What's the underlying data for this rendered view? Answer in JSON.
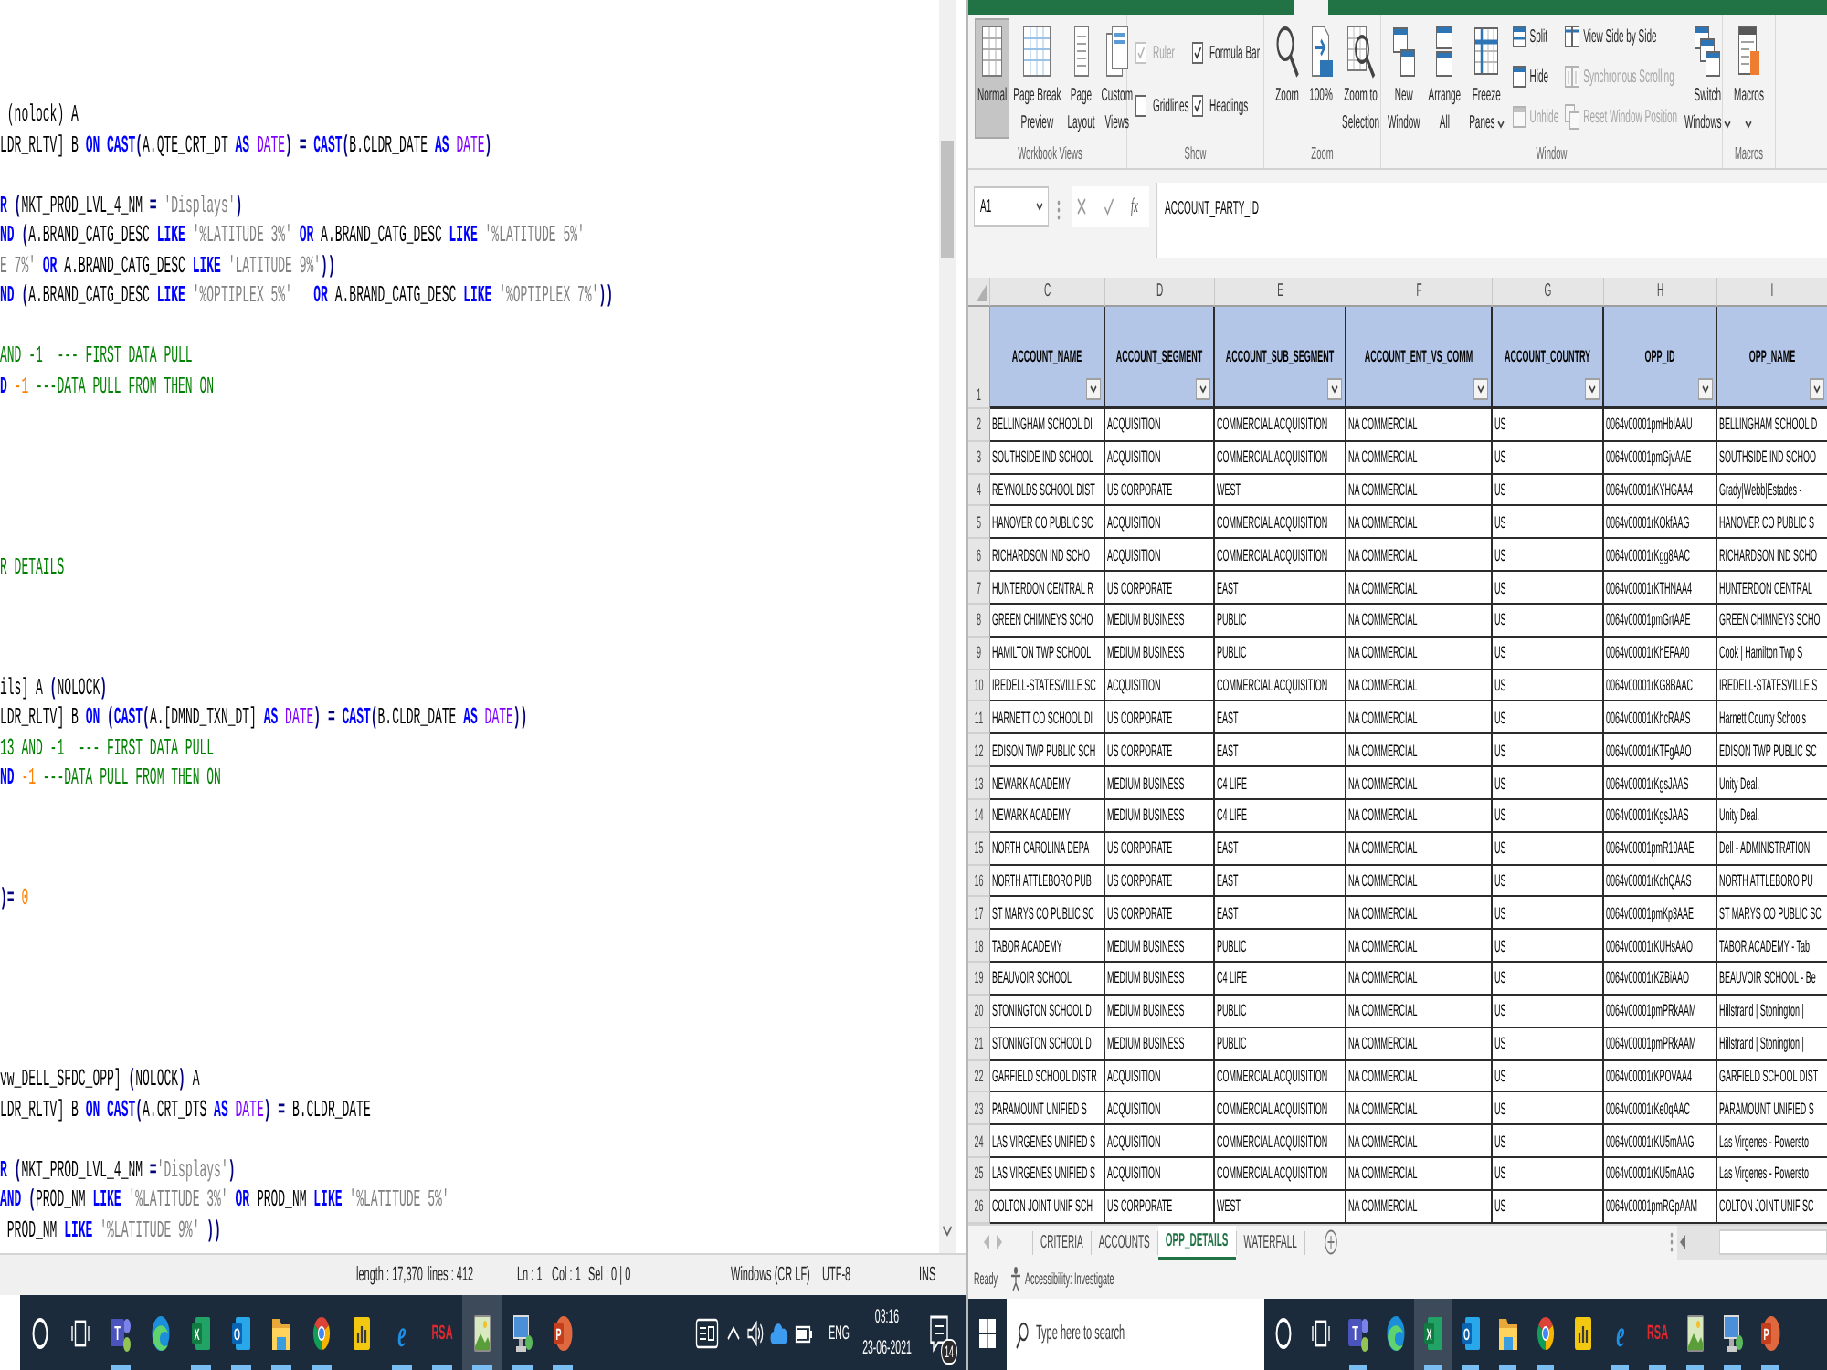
{
  "editor": {
    "lines": [
      {
        "kind": "code",
        "segments": [
          {
            "kind": "plain",
            "text": " (nolock) A"
          }
        ]
      },
      {
        "kind": "code",
        "segments": [
          {
            "kind": "plain",
            "text": "LDR_RLTV] B "
          },
          {
            "kind": "keyword",
            "text": "ON"
          },
          {
            "kind": "keyword",
            "text": " CAST"
          },
          {
            "kind": "operator",
            "text": "("
          },
          {
            "kind": "plain",
            "text": "A.QTE_CRT_DT "
          },
          {
            "kind": "keyword",
            "text": "AS"
          },
          {
            "kind": "type",
            "text": " DATE"
          },
          {
            "kind": "operator",
            "text": ") ="
          },
          {
            "kind": "keyword",
            "text": " CAST"
          },
          {
            "kind": "operator",
            "text": "("
          },
          {
            "kind": "plain",
            "text": "B.CLDR_DATE "
          },
          {
            "kind": "keyword",
            "text": "AS"
          },
          {
            "kind": "type",
            "text": " DATE"
          },
          {
            "kind": "operator",
            "text": ")"
          }
        ]
      },
      {
        "kind": "blank"
      },
      {
        "kind": "code",
        "segments": [
          {
            "kind": "keyword",
            "text": "R"
          },
          {
            "kind": "operator",
            "text": " ("
          },
          {
            "kind": "plain",
            "text": "MKT_PROD_LVL_4_NM "
          },
          {
            "kind": "operator",
            "text": "="
          },
          {
            "kind": "string",
            "text": " 'Displays'"
          },
          {
            "kind": "operator",
            "text": ")"
          }
        ]
      },
      {
        "kind": "code",
        "segments": [
          {
            "kind": "keyword",
            "text": "ND"
          },
          {
            "kind": "operator",
            "text": " ("
          },
          {
            "kind": "plain",
            "text": "A.BRAND_CATG_DESC "
          },
          {
            "kind": "keyword",
            "text": "LIKE"
          },
          {
            "kind": "string",
            "text": " '%LATITUDE 3%'"
          },
          {
            "kind": "keyword",
            "text": " OR"
          },
          {
            "kind": "plain",
            "text": " A.BRAND_CATG_DESC "
          },
          {
            "kind": "keyword",
            "text": "LIKE"
          },
          {
            "kind": "string",
            "text": " '%LATITUDE 5%'"
          }
        ]
      },
      {
        "kind": "code",
        "segments": [
          {
            "kind": "string",
            "text": "E 7%'"
          },
          {
            "kind": "keyword",
            "text": " OR"
          },
          {
            "kind": "plain",
            "text": " A.BRAND_CATG_DESC "
          },
          {
            "kind": "keyword",
            "text": "LIKE"
          },
          {
            "kind": "string",
            "text": " 'LATITUDE 9%'"
          },
          {
            "kind": "operator",
            "text": "))"
          }
        ]
      },
      {
        "kind": "code",
        "segments": [
          {
            "kind": "keyword",
            "text": "ND"
          },
          {
            "kind": "operator",
            "text": " ("
          },
          {
            "kind": "plain",
            "text": "A.BRAND_CATG_DESC "
          },
          {
            "kind": "keyword",
            "text": "LIKE"
          },
          {
            "kind": "string",
            "text": " '%OPTIPLEX 5%'"
          },
          {
            "kind": "keyword",
            "text": "   OR"
          },
          {
            "kind": "plain",
            "text": " A.BRAND_CATG_DESC "
          },
          {
            "kind": "keyword",
            "text": "LIKE"
          },
          {
            "kind": "string",
            "text": " '%OPTIPLEX 7%'"
          },
          {
            "kind": "operator",
            "text": "))"
          }
        ]
      },
      {
        "kind": "blank"
      },
      {
        "kind": "code",
        "segments": [
          {
            "kind": "comment",
            "text": "AND -1  --- FIRST DATA PULL"
          }
        ]
      },
      {
        "kind": "code",
        "segments": [
          {
            "kind": "keyword",
            "text": "D"
          },
          {
            "kind": "number",
            "text": " -1"
          },
          {
            "kind": "comment",
            "text": " ---DATA PULL FROM THEN ON"
          }
        ]
      },
      {
        "kind": "blank"
      },
      {
        "kind": "blank"
      },
      {
        "kind": "blank"
      },
      {
        "kind": "blank"
      },
      {
        "kind": "blank"
      },
      {
        "kind": "code",
        "segments": [
          {
            "kind": "comment",
            "text": "R DETAILS"
          }
        ]
      },
      {
        "kind": "blank"
      },
      {
        "kind": "blank"
      },
      {
        "kind": "blank"
      },
      {
        "kind": "code",
        "segments": [
          {
            "kind": "plain",
            "text": "ils] A "
          },
          {
            "kind": "operator",
            "text": "("
          },
          {
            "kind": "plain",
            "text": "NOLOCK"
          },
          {
            "kind": "operator",
            "text": ")"
          }
        ]
      },
      {
        "kind": "code",
        "segments": [
          {
            "kind": "plain",
            "text": "LDR_RLTV] B "
          },
          {
            "kind": "keyword",
            "text": "ON"
          },
          {
            "kind": "operator",
            "text": " ("
          },
          {
            "kind": "keyword",
            "text": "CAST"
          },
          {
            "kind": "operator",
            "text": "("
          },
          {
            "kind": "plain",
            "text": "A.[DMND_TXN_DT] "
          },
          {
            "kind": "keyword",
            "text": "AS"
          },
          {
            "kind": "type",
            "text": " DATE"
          },
          {
            "kind": "operator",
            "text": ") ="
          },
          {
            "kind": "keyword",
            "text": " CAST"
          },
          {
            "kind": "operator",
            "text": "("
          },
          {
            "kind": "plain",
            "text": "B.CLDR_DATE "
          },
          {
            "kind": "keyword",
            "text": "AS"
          },
          {
            "kind": "type",
            "text": " DATE"
          },
          {
            "kind": "operator",
            "text": "))"
          }
        ]
      },
      {
        "kind": "code",
        "segments": [
          {
            "kind": "comment",
            "text": "13 AND -1  --- FIRST DATA PULL"
          }
        ]
      },
      {
        "kind": "code",
        "segments": [
          {
            "kind": "keyword",
            "text": "ND"
          },
          {
            "kind": "number",
            "text": " -1"
          },
          {
            "kind": "comment",
            "text": " ---DATA PULL FROM THEN ON"
          }
        ]
      },
      {
        "kind": "blank"
      },
      {
        "kind": "blank"
      },
      {
        "kind": "blank"
      },
      {
        "kind": "code",
        "segments": [
          {
            "kind": "operator",
            "text": ")="
          },
          {
            "kind": "number",
            "text": " 0"
          }
        ]
      },
      {
        "kind": "blank"
      },
      {
        "kind": "blank"
      },
      {
        "kind": "blank"
      },
      {
        "kind": "blank"
      },
      {
        "kind": "blank"
      },
      {
        "kind": "code",
        "segments": [
          {
            "kind": "plain",
            "text": "vw_DELL_SFDC_OPP] "
          },
          {
            "kind": "operator",
            "text": "("
          },
          {
            "kind": "plain",
            "text": "NOLOCK"
          },
          {
            "kind": "operator",
            "text": ")"
          },
          {
            "kind": "plain",
            "text": " A"
          }
        ]
      },
      {
        "kind": "code",
        "segments": [
          {
            "kind": "plain",
            "text": "LDR_RLTV] B "
          },
          {
            "kind": "keyword",
            "text": "ON"
          },
          {
            "kind": "keyword",
            "text": " CAST"
          },
          {
            "kind": "operator",
            "text": "("
          },
          {
            "kind": "plain",
            "text": "A.CRT_DTS "
          },
          {
            "kind": "keyword",
            "text": "AS"
          },
          {
            "kind": "type",
            "text": " DATE"
          },
          {
            "kind": "operator",
            "text": ") ="
          },
          {
            "kind": "plain",
            "text": " B.CLDR_DATE"
          }
        ]
      },
      {
        "kind": "blank"
      },
      {
        "kind": "code",
        "segments": [
          {
            "kind": "keyword",
            "text": "R"
          },
          {
            "kind": "operator",
            "text": " ("
          },
          {
            "kind": "plain",
            "text": "MKT_PROD_LVL_4_NM "
          },
          {
            "kind": "operator",
            "text": "="
          },
          {
            "kind": "string",
            "text": "'Displays'"
          },
          {
            "kind": "operator",
            "text": ")"
          }
        ]
      },
      {
        "kind": "code",
        "segments": [
          {
            "kind": "keyword",
            "text": "AND"
          },
          {
            "kind": "operator",
            "text": " ("
          },
          {
            "kind": "plain",
            "text": "PROD_NM "
          },
          {
            "kind": "keyword",
            "text": "LIKE"
          },
          {
            "kind": "string",
            "text": " '%LATITUDE 3%'"
          },
          {
            "kind": "keyword",
            "text": " OR"
          },
          {
            "kind": "plain",
            "text": " PROD_NM "
          },
          {
            "kind": "keyword",
            "text": "LIKE"
          },
          {
            "kind": "string",
            "text": " '%LATITUDE 5%'"
          }
        ]
      },
      {
        "kind": "code",
        "segments": [
          {
            "kind": "plain",
            "text": " PROD_NM "
          },
          {
            "kind": "keyword",
            "text": "LIKE"
          },
          {
            "kind": "string",
            "text": " '%LATITUDE 9%'"
          },
          {
            "kind": "operator",
            "text": " ))"
          }
        ]
      }
    ],
    "status_bar": [
      "length : 17,370",
      "lines : 412",
      "Ln : 1",
      "Col : 1",
      "Sel : 0 | 0",
      "Windows (CR LF)",
      "UTF-8",
      "INS"
    ]
  },
  "secondary_taskbar": {
    "apps": [
      {
        "kind": "cortana",
        "running": false,
        "selected": false
      },
      {
        "kind": "taskview",
        "running": false,
        "selected": false
      },
      {
        "kind": "teams",
        "label": "T",
        "running": true,
        "selected": false
      },
      {
        "kind": "edge",
        "running": false,
        "selected": false
      },
      {
        "kind": "excel",
        "label": "X",
        "running": true,
        "selected": false
      },
      {
        "kind": "outlook",
        "label": "O",
        "running": true,
        "selected": false
      },
      {
        "kind": "explorer",
        "running": true,
        "selected": false
      },
      {
        "kind": "chrome",
        "running": true,
        "selected": false
      },
      {
        "kind": "powerbi",
        "running": false,
        "selected": false
      },
      {
        "kind": "ie",
        "label": "e",
        "running": true,
        "selected": false
      },
      {
        "kind": "rsa",
        "label": "RSA",
        "running": true,
        "selected": false
      },
      {
        "kind": "photos",
        "running": true,
        "selected": true
      },
      {
        "kind": "computer",
        "running": true,
        "selected": false
      },
      {
        "kind": "powerpoint",
        "label": "P",
        "running": true,
        "selected": false
      }
    ],
    "tray": {
      "language": "ENG",
      "time": "03:16",
      "date": "23-06-2021",
      "notification_count": "14"
    }
  },
  "excel": {
    "ribbon": {
      "groups": [
        {
          "label": "Workbook Views",
          "items": [
            {
              "kind": "large",
              "lines": [
                "Normal"
              ],
              "selected": true,
              "dropdown": false
            },
            {
              "kind": "large",
              "lines": [
                "Page Break",
                "Preview"
              ],
              "selected": false,
              "dropdown": false
            },
            {
              "kind": "large",
              "lines": [
                "Page",
                "Layout"
              ],
              "selected": false,
              "dropdown": false
            },
            {
              "kind": "large",
              "lines": [
                "Custom",
                "Views"
              ],
              "selected": false,
              "dropdown": false
            }
          ]
        },
        {
          "label": "Show",
          "items": [
            {
              "kind": "stack",
              "items": [
                {
                  "kind": "check",
                  "label": "Ruler",
                  "checked": true,
                  "disabled": true
                },
                {
                  "kind": "check",
                  "label": "Gridlines",
                  "checked": false,
                  "disabled": false
                }
              ]
            },
            {
              "kind": "stack",
              "items": [
                {
                  "kind": "check",
                  "label": "Formula Bar",
                  "checked": true,
                  "disabled": false
                },
                {
                  "kind": "check",
                  "label": "Headings",
                  "checked": true,
                  "disabled": false
                }
              ]
            }
          ]
        },
        {
          "label": "Zoom",
          "items": [
            {
              "kind": "large",
              "lines": [
                "Zoom"
              ],
              "selected": false,
              "dropdown": false
            },
            {
              "kind": "large",
              "lines": [
                "100%"
              ],
              "selected": false,
              "dropdown": false
            },
            {
              "kind": "large",
              "lines": [
                "Zoom to",
                "Selection"
              ],
              "selected": false,
              "dropdown": false
            }
          ]
        },
        {
          "label": "Window",
          "items": [
            {
              "kind": "large",
              "lines": [
                "New",
                "Window"
              ],
              "selected": false,
              "dropdown": false
            },
            {
              "kind": "large",
              "lines": [
                "Arrange",
                "All"
              ],
              "selected": false,
              "dropdown": false
            },
            {
              "kind": "large",
              "lines": [
                "Freeze",
                "Panes"
              ],
              "selected": false,
              "dropdown": true
            },
            {
              "kind": "stack",
              "items": [
                {
                  "kind": "small",
                  "label": "Split",
                  "disabled": false
                },
                {
                  "kind": "small",
                  "label": "Hide",
                  "disabled": false
                },
                {
                  "kind": "small",
                  "label": "Unhide",
                  "disabled": true
                }
              ]
            },
            {
              "kind": "stack",
              "items": [
                {
                  "kind": "small",
                  "label": "View Side by Side",
                  "disabled": false
                },
                {
                  "kind": "small",
                  "label": "Synchronous Scrolling",
                  "disabled": true
                },
                {
                  "kind": "small",
                  "label": "Reset Window Position",
                  "disabled": true
                }
              ]
            },
            {
              "kind": "large",
              "lines": [
                "Switch",
                "Windows"
              ],
              "selected": false,
              "dropdown": true
            }
          ]
        },
        {
          "label": "Macros",
          "items": [
            {
              "kind": "large",
              "lines": [
                "Macros"
              ],
              "selected": false,
              "dropdown": true
            }
          ]
        }
      ]
    },
    "name_box": "A1",
    "function_label": "fx",
    "formula": "ACCOUNT_PARTY_ID",
    "column_letters": [
      "C",
      "D",
      "E",
      "F",
      "G",
      "H",
      "I"
    ],
    "header_row": {
      "number": "1",
      "cells": [
        "ACCOUNT_NAME",
        "ACCOUNT_SEGMENT",
        "ACCOUNT_SUB_SEGMENT",
        "ACCOUNT_ENT_VS_COMM",
        "ACCOUNT_COUNTRY",
        "OPP_ID",
        "OPP_NAME"
      ]
    },
    "rows": [
      {
        "number": "2",
        "cells": [
          "BELLINGHAM SCHOOL DI",
          "ACQUISITION",
          "COMMERCIAL ACQUISITION",
          "NA COMMERCIAL",
          "US",
          "0064v00001pmHbIAAU",
          "BELLINGHAM SCHOOL D"
        ]
      },
      {
        "number": "3",
        "cells": [
          "SOUTHSIDE IND SCHOOL",
          "ACQUISITION",
          "COMMERCIAL ACQUISITION",
          "NA COMMERCIAL",
          "US",
          "0064v00001pmGjvAAE",
          "SOUTHSIDE IND SCHOO"
        ]
      },
      {
        "number": "4",
        "cells": [
          "REYNOLDS SCHOOL DIST",
          "US CORPORATE",
          "WEST",
          "NA COMMERCIAL",
          "US",
          "0064v00001rKYHGAA4",
          "Grady|Webb|Estades -"
        ]
      },
      {
        "number": "5",
        "cells": [
          "HANOVER CO PUBLIC SC",
          "ACQUISITION",
          "COMMERCIAL ACQUISITION",
          "NA COMMERCIAL",
          "US",
          "0064v00001rKOkfAAG",
          "HANOVER CO PUBLIC S"
        ]
      },
      {
        "number": "6",
        "cells": [
          "RICHARDSON IND SCHO",
          "ACQUISITION",
          "COMMERCIAL ACQUISITION",
          "NA COMMERCIAL",
          "US",
          "0064v00001rKgg8AAC",
          "RICHARDSON IND SCHO"
        ]
      },
      {
        "number": "7",
        "cells": [
          "HUNTERDON CENTRAL R",
          "US CORPORATE",
          "EAST",
          "NA COMMERCIAL",
          "US",
          "0064v00001rKTHNAA4",
          "HUNTERDON CENTRAL"
        ]
      },
      {
        "number": "8",
        "cells": [
          "GREEN CHIMNEYS SCHO",
          "MEDIUM BUSINESS",
          "PUBLIC",
          "NA COMMERCIAL",
          "US",
          "0064v00001pmGrtAAE",
          "GREEN CHIMNEYS SCHO"
        ]
      },
      {
        "number": "9",
        "cells": [
          "HAMILTON TWP SCHOOL",
          "MEDIUM BUSINESS",
          "PUBLIC",
          "NA COMMERCIAL",
          "US",
          "0064v00001rKhEFAA0",
          "Cook | Hamilton Twp S"
        ]
      },
      {
        "number": "10",
        "cells": [
          "IREDELL-STATESVILLE SC",
          "ACQUISITION",
          "COMMERCIAL ACQUISITION",
          "NA COMMERCIAL",
          "US",
          "0064v00001rKG8BAAC",
          "IREDELL-STATESVILLE S"
        ]
      },
      {
        "number": "11",
        "cells": [
          "HARNETT CO SCHOOL DI",
          "US CORPORATE",
          "EAST",
          "NA COMMERCIAL",
          "US",
          "0064v00001rKhcRAAS",
          "Harnett County Schools"
        ]
      },
      {
        "number": "12",
        "cells": [
          "EDISON TWP PUBLIC SCH",
          "US CORPORATE",
          "EAST",
          "NA COMMERCIAL",
          "US",
          "0064v00001rKTFgAAO",
          "EDISON TWP PUBLIC SC"
        ]
      },
      {
        "number": "13",
        "cells": [
          "NEWARK ACADEMY",
          "MEDIUM BUSINESS",
          "C4 LIFE",
          "NA COMMERCIAL",
          "US",
          "0064v00001rKgsJAAS",
          "Unity Deal."
        ]
      },
      {
        "number": "14",
        "cells": [
          "NEWARK ACADEMY",
          "MEDIUM BUSINESS",
          "C4 LIFE",
          "NA COMMERCIAL",
          "US",
          "0064v00001rKgsJAAS",
          "Unity Deal."
        ]
      },
      {
        "number": "15",
        "cells": [
          "NORTH CAROLINA DEPA",
          "US CORPORATE",
          "EAST",
          "NA COMMERCIAL",
          "US",
          "0064v00001pmR10AAE",
          "Dell - ADMINISTRATION"
        ]
      },
      {
        "number": "16",
        "cells": [
          "NORTH ATTLEBORO PUB",
          "US CORPORATE",
          "EAST",
          "NA COMMERCIAL",
          "US",
          "0064v00001rKdhQAAS",
          "NORTH ATTLEBORO PU"
        ]
      },
      {
        "number": "17",
        "cells": [
          "ST MARYS CO PUBLIC SC",
          "US CORPORATE",
          "EAST",
          "NA COMMERCIAL",
          "US",
          "0064v00001pmKp3AAE",
          "ST MARYS CO PUBLIC SC"
        ]
      },
      {
        "number": "18",
        "cells": [
          "TABOR ACADEMY",
          "MEDIUM BUSINESS",
          "PUBLIC",
          "NA COMMERCIAL",
          "US",
          "0064v00001rKUHsAAO",
          "TABOR ACADEMY - Tab"
        ]
      },
      {
        "number": "19",
        "cells": [
          "BEAUVOIR SCHOOL",
          "MEDIUM BUSINESS",
          "C4 LIFE",
          "NA COMMERCIAL",
          "US",
          "0064v00001rKZBiAAO",
          "BEAUVOIR SCHOOL - Be"
        ]
      },
      {
        "number": "20",
        "cells": [
          "STONINGTON SCHOOL D",
          "MEDIUM BUSINESS",
          "PUBLIC",
          "NA COMMERCIAL",
          "US",
          "0064v00001pmPRkAAM",
          "Hillstrand | Stonington |"
        ]
      },
      {
        "number": "21",
        "cells": [
          "STONINGTON SCHOOL D",
          "MEDIUM BUSINESS",
          "PUBLIC",
          "NA COMMERCIAL",
          "US",
          "0064v00001pmPRkAAM",
          "Hillstrand | Stonington |"
        ]
      },
      {
        "number": "22",
        "cells": [
          "GARFIELD SCHOOL DISTR",
          "ACQUISITION",
          "COMMERCIAL ACQUISITION",
          "NA COMMERCIAL",
          "US",
          "0064v00001rKPOVAA4",
          "GARFIELD SCHOOL DIST"
        ]
      },
      {
        "number": "23",
        "cells": [
          "PARAMOUNT UNIFIED S",
          "ACQUISITION",
          "COMMERCIAL ACQUISITION",
          "NA COMMERCIAL",
          "US",
          "0064v00001rKe0qAAC",
          "PARAMOUNT UNIFIED S"
        ]
      },
      {
        "number": "24",
        "cells": [
          "LAS VIRGENES UNIFIED S",
          "ACQUISITION",
          "COMMERCIAL ACQUISITION",
          "NA COMMERCIAL",
          "US",
          "0064v00001rKU5mAAG",
          "Las Virgenes - Powersto"
        ]
      },
      {
        "number": "25",
        "cells": [
          "LAS VIRGENES UNIFIED S",
          "ACQUISITION",
          "COMMERCIAL ACQUISITION",
          "NA COMMERCIAL",
          "US",
          "0064v00001rKU5mAAG",
          "Las Virgenes - Powersto"
        ]
      },
      {
        "number": "26",
        "cells": [
          "COLTON JOINT UNIF SCH",
          "US CORPORATE",
          "WEST",
          "NA COMMERCIAL",
          "US",
          "0064v00001pmRGpAAM",
          "COLTON JOINT UNIF SC"
        ]
      }
    ],
    "sheet_tabs": [
      {
        "label": "CRITERIA",
        "selected": false
      },
      {
        "label": "ACCOUNTS",
        "selected": false
      },
      {
        "label": "OPP_DETAILS",
        "selected": true
      },
      {
        "label": "WATERFALL",
        "selected": false
      }
    ],
    "status": "Ready",
    "accessibility": "Accessibility: Investigate"
  },
  "main_taskbar": {
    "search": {
      "placeholder": "Type here to search"
    },
    "apps": [
      {
        "kind": "cortana",
        "running": false,
        "selected": false
      },
      {
        "kind": "taskview",
        "running": false,
        "selected": false
      },
      {
        "kind": "teams",
        "label": "T",
        "running": true,
        "selected": false
      },
      {
        "kind": "edge",
        "running": false,
        "selected": false
      },
      {
        "kind": "excel",
        "label": "X",
        "running": true,
        "selected": true
      },
      {
        "kind": "outlook",
        "label": "O",
        "running": true,
        "selected": false
      },
      {
        "kind": "explorer",
        "running": true,
        "selected": false
      },
      {
        "kind": "chrome",
        "running": true,
        "selected": false
      },
      {
        "kind": "powerbi",
        "running": false,
        "selected": false
      },
      {
        "kind": "ie",
        "label": "e",
        "running": true,
        "selected": false
      },
      {
        "kind": "rsa",
        "label": "RSA",
        "running": true,
        "selected": false
      },
      {
        "kind": "photos",
        "running": true,
        "selected": false
      },
      {
        "kind": "computer",
        "running": true,
        "selected": false
      },
      {
        "kind": "powerpoint",
        "label": "P",
        "running": true,
        "selected": false
      }
    ]
  }
}
